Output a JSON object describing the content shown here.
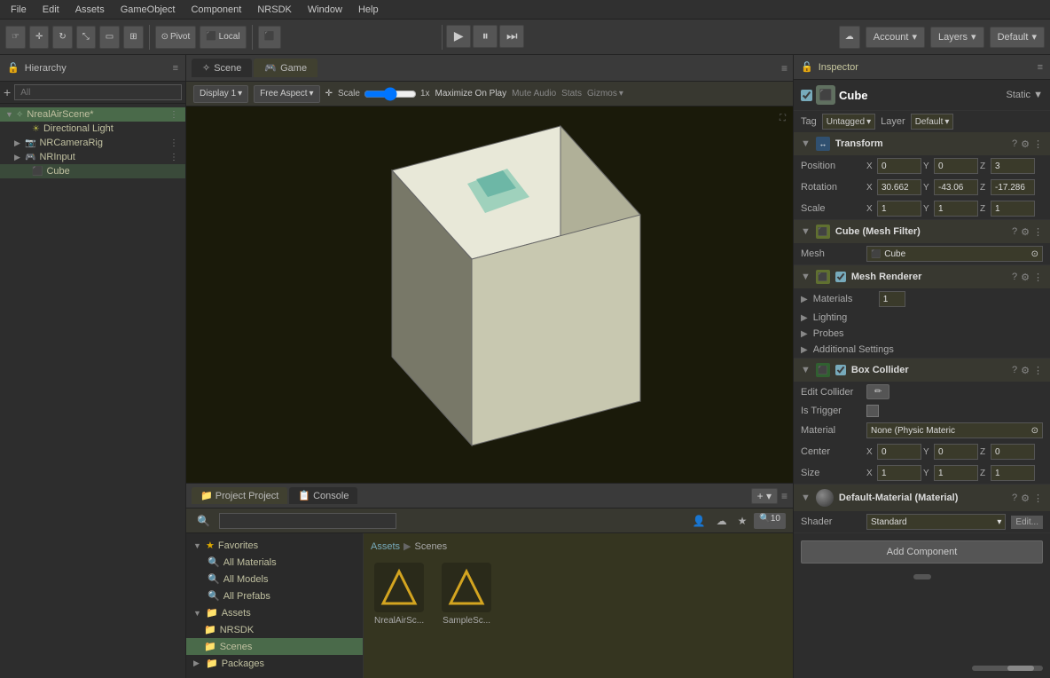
{
  "menubar": {
    "items": [
      "File",
      "Edit",
      "Assets",
      "GameObject",
      "Component",
      "NRSDK",
      "Window",
      "Help"
    ]
  },
  "toolbar": {
    "tools": [
      "hand",
      "move",
      "rotate",
      "scale",
      "rect",
      "transform"
    ],
    "pivot_label": "Pivot",
    "local_label": "Local",
    "play": "▶",
    "pause": "⏸",
    "step": "⏭",
    "account_label": "Account",
    "layers_label": "Layers",
    "default_label": "Default"
  },
  "hierarchy": {
    "title": "Hierarchy",
    "search_placeholder": "All",
    "items": [
      {
        "id": "scene",
        "label": "NrealAirScene*",
        "level": "root",
        "expanded": true,
        "icon": "🎬"
      },
      {
        "id": "light",
        "label": "Directional Light",
        "level": "lvl2",
        "icon": "💡"
      },
      {
        "id": "camera",
        "label": "NRCameraRig",
        "level": "lvl2",
        "icon": "📷",
        "expanded": true
      },
      {
        "id": "input",
        "label": "NRInput",
        "level": "lvl2",
        "icon": "🎮",
        "expanded": true
      },
      {
        "id": "cube",
        "label": "Cube",
        "level": "lvl2",
        "icon": "⬛"
      }
    ]
  },
  "scene": {
    "tabs": [
      {
        "label": "Scene",
        "icon": "✧"
      },
      {
        "label": "Game",
        "icon": "🎮"
      }
    ],
    "active_tab": "Game",
    "toolbar": {
      "display": "Display 1",
      "aspect": "Free Aspect",
      "scale_label": "Scale",
      "scale_value": "1x",
      "maximize": "Maximize On Play",
      "mute": "Mute Audio",
      "stats": "Stats",
      "gizmos": "Gizmos"
    }
  },
  "inspector": {
    "title": "Inspector",
    "object": {
      "name": "Cube",
      "static": "Static ▼",
      "tag": "Untagged",
      "layer": "Default"
    },
    "transform": {
      "title": "Transform",
      "position": {
        "x": "0",
        "y": "0",
        "z": "3"
      },
      "rotation": {
        "x": "30.662",
        "y": "-43.06",
        "z": "-17.286"
      },
      "scale": {
        "x": "1",
        "y": "1",
        "z": "1"
      }
    },
    "mesh_filter": {
      "title": "Cube (Mesh Filter)",
      "mesh": "Cube"
    },
    "mesh_renderer": {
      "title": "Mesh Renderer",
      "materials": {
        "label": "Materials",
        "count": "1"
      },
      "lighting": "Lighting",
      "probes": "Probes",
      "additional": "Additional Settings"
    },
    "box_collider": {
      "title": "Box Collider",
      "edit_collider": "Edit Collider",
      "is_trigger": "Is Trigger",
      "material": "Material",
      "material_value": "None (Physic Materic",
      "center": {
        "x": "0",
        "y": "0",
        "z": "0"
      },
      "size": {
        "x": "1",
        "y": "1",
        "z": "1"
      }
    },
    "material": {
      "title": "Default-Material (Material)",
      "shader": "Shader",
      "shader_value": "Standard",
      "edit": "Edit..."
    },
    "add_component": "Add Component"
  },
  "project": {
    "tabs": [
      "Project",
      "Console"
    ],
    "active_tab": "Project",
    "breadcrumb": [
      "Assets",
      "Scenes"
    ],
    "search_placeholder": "",
    "favorites": {
      "label": "Favorites",
      "items": [
        "All Materials",
        "All Models",
        "All Prefabs"
      ]
    },
    "assets_tree": [
      {
        "label": "Assets",
        "expanded": true
      },
      {
        "label": "NRSDK",
        "level": 1
      },
      {
        "label": "Scenes",
        "level": 1,
        "selected": true
      },
      {
        "label": "Packages",
        "expanded": false
      }
    ],
    "scene_assets": [
      {
        "label": "NrealAirSc...",
        "icon": "unity"
      },
      {
        "label": "SampleSc...",
        "icon": "unity"
      }
    ]
  }
}
